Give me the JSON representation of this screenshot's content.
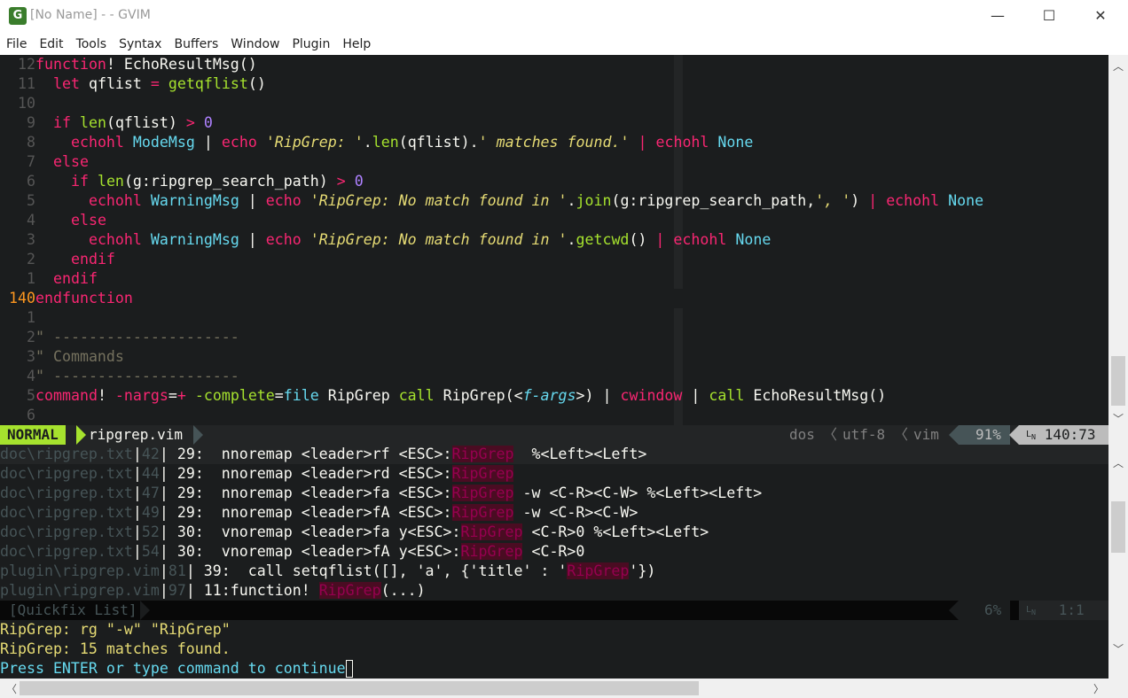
{
  "window": {
    "title": "[No Name] - - GVIM",
    "icon_glyph": "G",
    "minimize": "—",
    "maximize": "☐",
    "close": "✕"
  },
  "menu": [
    "File",
    "Edit",
    "Tools",
    "Syntax",
    "Buffers",
    "Window",
    "Plugin",
    "Help"
  ],
  "editor": {
    "lines": [
      {
        "num": "12",
        "tokens": [
          [
            "kw",
            "function"
          ],
          [
            "code",
            "! EchoResultMsg()"
          ]
        ]
      },
      {
        "num": "11",
        "tokens": [
          [
            "code",
            "  "
          ],
          [
            "kw",
            "let"
          ],
          [
            "code",
            " qflist "
          ],
          [
            "kw",
            "="
          ],
          [
            "code",
            " "
          ],
          [
            "fn",
            "getqflist"
          ],
          [
            "code",
            "()"
          ]
        ]
      },
      {
        "num": "10",
        "tokens": []
      },
      {
        "num": "9",
        "tokens": [
          [
            "code",
            "  "
          ],
          [
            "kw",
            "if"
          ],
          [
            "code",
            " "
          ],
          [
            "fn",
            "len"
          ],
          [
            "code",
            "(qflist) "
          ],
          [
            "kw",
            ">"
          ],
          [
            "code",
            " "
          ],
          [
            "num",
            "0"
          ]
        ]
      },
      {
        "num": "8",
        "tokens": [
          [
            "code",
            "    "
          ],
          [
            "kw",
            "echohl"
          ],
          [
            "code",
            " "
          ],
          [
            "typ",
            "ModeMsg"
          ],
          [
            "code",
            " | "
          ],
          [
            "kw",
            "echo"
          ],
          [
            "code",
            " "
          ],
          [
            "str",
            "'RipGrep: '"
          ],
          [
            "code",
            "."
          ],
          [
            "fn",
            "len"
          ],
          [
            "code",
            "(qflist)."
          ],
          [
            "str",
            "' matches found.'"
          ],
          [
            "code",
            " "
          ],
          [
            "kw",
            "|"
          ],
          [
            "code",
            " "
          ],
          [
            "kw",
            "echohl"
          ],
          [
            "code",
            " "
          ],
          [
            "typ",
            "None"
          ]
        ]
      },
      {
        "num": "7",
        "tokens": [
          [
            "code",
            "  "
          ],
          [
            "kw",
            "else"
          ]
        ]
      },
      {
        "num": "6",
        "tokens": [
          [
            "code",
            "    "
          ],
          [
            "kw",
            "if"
          ],
          [
            "code",
            " "
          ],
          [
            "fn",
            "len"
          ],
          [
            "code",
            "(g:ripgrep_search_path) "
          ],
          [
            "kw",
            ">"
          ],
          [
            "code",
            " "
          ],
          [
            "num",
            "0"
          ]
        ]
      },
      {
        "num": "5",
        "tokens": [
          [
            "code",
            "      "
          ],
          [
            "kw",
            "echohl"
          ],
          [
            "code",
            " "
          ],
          [
            "typ",
            "WarningMsg"
          ],
          [
            "code",
            " | "
          ],
          [
            "kw",
            "echo"
          ],
          [
            "code",
            " "
          ],
          [
            "str",
            "'RipGrep: No match found in '"
          ],
          [
            "code",
            "."
          ],
          [
            "fn",
            "join"
          ],
          [
            "code",
            "(g:ripgrep_search_path,"
          ],
          [
            "str",
            "', '"
          ],
          [
            "code",
            ") "
          ],
          [
            "kw",
            "|"
          ],
          [
            "code",
            " "
          ],
          [
            "kw",
            "echohl"
          ],
          [
            "code",
            " "
          ],
          [
            "typ",
            "None"
          ]
        ]
      },
      {
        "num": "4",
        "tokens": [
          [
            "code",
            "    "
          ],
          [
            "kw",
            "else"
          ]
        ]
      },
      {
        "num": "3",
        "tokens": [
          [
            "code",
            "      "
          ],
          [
            "kw",
            "echohl"
          ],
          [
            "code",
            " "
          ],
          [
            "typ",
            "WarningMsg"
          ],
          [
            "code",
            " | "
          ],
          [
            "kw",
            "echo"
          ],
          [
            "code",
            " "
          ],
          [
            "str",
            "'RipGrep: No match found in '"
          ],
          [
            "code",
            "."
          ],
          [
            "fn",
            "getcwd"
          ],
          [
            "code",
            "() "
          ],
          [
            "kw",
            "|"
          ],
          [
            "code",
            " "
          ],
          [
            "kw",
            "echohl"
          ],
          [
            "code",
            " "
          ],
          [
            "typ",
            "None"
          ]
        ]
      },
      {
        "num": "2",
        "tokens": [
          [
            "code",
            "    "
          ],
          [
            "kw",
            "endif"
          ]
        ]
      },
      {
        "num": "1",
        "tokens": [
          [
            "code",
            "  "
          ],
          [
            "kw",
            "endif"
          ]
        ]
      },
      {
        "num": "140",
        "current": true,
        "tokens": [
          [
            "kw",
            "endfunction"
          ]
        ]
      },
      {
        "num": "1",
        "tokens": []
      },
      {
        "num": "2",
        "tokens": [
          [
            "cm",
            "\" ---------------------"
          ]
        ]
      },
      {
        "num": "3",
        "tokens": [
          [
            "cm",
            "\" Commands"
          ]
        ]
      },
      {
        "num": "4",
        "tokens": [
          [
            "cm",
            "\" ---------------------"
          ]
        ]
      },
      {
        "num": "5",
        "tokens": [
          [
            "kw",
            "command"
          ],
          [
            "code",
            "! "
          ],
          [
            "kw",
            "-nargs"
          ],
          [
            "code",
            "="
          ],
          [
            "kw",
            "+"
          ],
          [
            "code",
            " "
          ],
          [
            "fn",
            "-complete"
          ],
          [
            "code",
            "="
          ],
          [
            "typ",
            "file"
          ],
          [
            "code",
            " RipGrep "
          ],
          [
            "fn",
            "call"
          ],
          [
            "code",
            " RipGrep(<"
          ],
          [
            "arg",
            "f-args"
          ],
          [
            "code",
            ">) | "
          ],
          [
            "kw",
            "cwindow"
          ],
          [
            "code",
            " | "
          ],
          [
            "fn",
            "call"
          ],
          [
            "code",
            " EchoResultMsg()"
          ]
        ]
      },
      {
        "num": "6",
        "tokens": []
      }
    ]
  },
  "statusline": {
    "mode": "NORMAL",
    "filename": "ripgrep.vim",
    "fileformat": "dos",
    "encoding": "utf-8",
    "filetype": "vim",
    "percent": "91%",
    "ln_icon": "ln-icon",
    "position": "140:73"
  },
  "quickfix": {
    "lines": [
      {
        "file": "doc\\ripgrep.txt",
        "line": "42",
        "rest_before": " 29:  nnoremap <leader>rf <ESC>:",
        "match": "RipGrep",
        "rest_after": "  %<Left><Left>",
        "selected": true
      },
      {
        "file": "doc\\ripgrep.txt",
        "line": "44",
        "rest_before": " 29:  nnoremap <leader>rd <ESC>:",
        "match": "RipGrep",
        "rest_after": ""
      },
      {
        "file": "doc\\ripgrep.txt",
        "line": "47",
        "rest_before": " 29:  nnoremap <leader>fa <ESC>:",
        "match": "RipGrep",
        "rest_after": " -w <C-R><C-W> %<Left><Left>"
      },
      {
        "file": "doc\\ripgrep.txt",
        "line": "49",
        "rest_before": " 29:  nnoremap <leader>fA <ESC>:",
        "match": "RipGrep",
        "rest_after": " -w <C-R><C-W>"
      },
      {
        "file": "doc\\ripgrep.txt",
        "line": "52",
        "rest_before": " 30:  vnoremap <leader>fa y<ESC>:",
        "match": "RipGrep",
        "rest_after": " <C-R>0 %<Left><Left>"
      },
      {
        "file": "doc\\ripgrep.txt",
        "line": "54",
        "rest_before": " 30:  vnoremap <leader>fA y<ESC>:",
        "match": "RipGrep",
        "rest_after": " <C-R>0"
      },
      {
        "file": "plugin\\ripgrep.vim",
        "line": "81",
        "rest_before": " 39:  call setqflist([], 'a', {'title' : '",
        "match": "RipGrep",
        "rest_after": "'})"
      },
      {
        "file": "plugin\\ripgrep.vim",
        "line": "97",
        "rest_before": " 11:function! ",
        "match": "RipGrep",
        "rest_after": "(...)"
      }
    ],
    "status_name": "[Quickfix List]",
    "status_percent": "6%",
    "status_position": "1:1"
  },
  "messages": {
    "line1": "RipGrep: rg \"-w\" \"RipGrep\"",
    "line2": "RipGrep: 15 matches found.",
    "prompt": "Press ENTER or type command to continue"
  },
  "colors": {
    "background": "#1b1d1e",
    "keyword": "#f92672",
    "function": "#a6e22e",
    "string": "#e6db74",
    "type": "#66d9ef",
    "mode_badge": "#a6e22e"
  }
}
